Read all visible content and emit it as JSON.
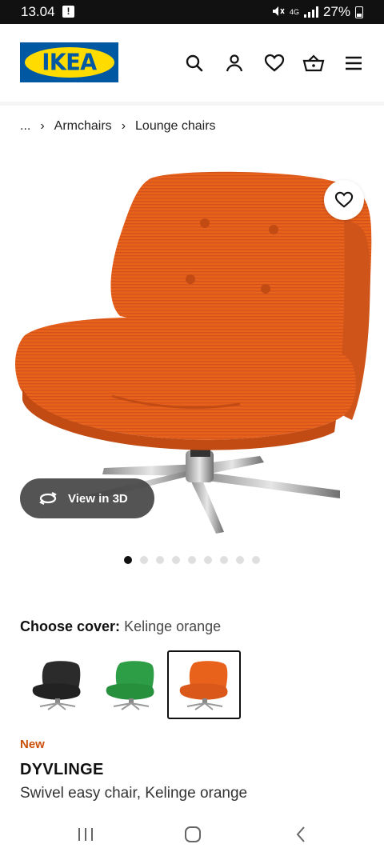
{
  "status_bar": {
    "time": "13.04",
    "alert_glyph": "!",
    "network": "4G",
    "battery": "27%"
  },
  "header": {
    "logo_text": "IKEA",
    "icons": [
      "search-icon",
      "account-icon",
      "heart-icon",
      "basket-icon",
      "menu-icon"
    ]
  },
  "breadcrumb": {
    "items": [
      "...",
      "Armchairs",
      "Lounge chairs"
    ]
  },
  "product_image": {
    "view_3d_label": "View in 3D",
    "slide_count": 9,
    "active_slide": 1
  },
  "cover": {
    "label": "Choose cover:",
    "value": "Kelinge orange",
    "options": [
      {
        "color": "#2b2b2b"
      },
      {
        "color": "#2e9e46"
      },
      {
        "color": "#e8621c",
        "selected": true
      }
    ]
  },
  "product": {
    "badge": "New",
    "name": "DYVLINGE",
    "description": "Swivel easy chair, Kelinge orange"
  },
  "colors": {
    "ikea_blue": "#0058a3",
    "ikea_yellow": "#ffdb00",
    "new_badge": "#ca5008",
    "chair_orange": "#e8621c"
  }
}
